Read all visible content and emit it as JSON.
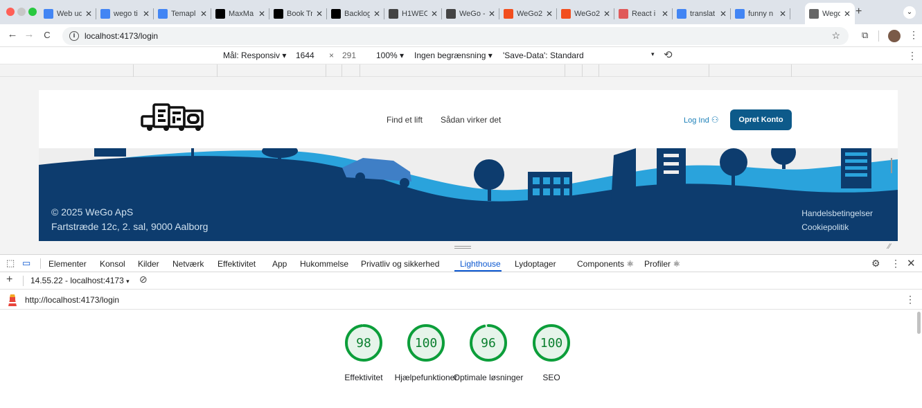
{
  "browser": {
    "tabs": [
      {
        "label": "Web ud",
        "icon": "docs-icon",
        "color": "#4285f4"
      },
      {
        "label": "wego ti",
        "icon": "docs-icon",
        "color": "#4285f4"
      },
      {
        "label": "Temapl",
        "icon": "docs-icon",
        "color": "#4285f4"
      },
      {
        "label": "MaxMa",
        "icon": "github-icon",
        "color": "#000000"
      },
      {
        "label": "Book Tr",
        "icon": "github-icon",
        "color": "#000000"
      },
      {
        "label": "Backlog",
        "icon": "github-icon",
        "color": "#000000"
      },
      {
        "label": "H1WEO",
        "icon": "check-circle-icon",
        "color": "#444444"
      },
      {
        "label": "WeGo -",
        "icon": "globe-icon",
        "color": "#444444"
      },
      {
        "label": "WeGo2",
        "icon": "figma-icon",
        "color": "#f24e1e"
      },
      {
        "label": "WeGo2",
        "icon": "figma-icon",
        "color": "#f24e1e"
      },
      {
        "label": "React i",
        "icon": "react-icon",
        "color": "#e05a5a"
      },
      {
        "label": "translat",
        "icon": "google-icon",
        "color": "#4285f4"
      },
      {
        "label": "funny n",
        "icon": "google-icon",
        "color": "#4285f4"
      },
      {
        "label": "Wego",
        "icon": "wego-icon",
        "color": "#666666",
        "active": true
      }
    ],
    "new_tab": "+",
    "url": "localhost:4173/login"
  },
  "device_toolbar": {
    "dimensions_label": "Mål: Responsiv",
    "width": "1644",
    "x": "×",
    "height": "291",
    "zoom": "100%",
    "throttle": "Ingen begrænsning",
    "save_data": "'Save-Data': Standard"
  },
  "site": {
    "logo": "WEGO",
    "nav": [
      "Find et lift",
      "Sådan virker det"
    ],
    "login": "Log Ind",
    "signup": "Opret Konto",
    "copyright": "© 2025 WeGo ApS",
    "address": "Fartstræde 12c, 2. sal, 9000 Aalborg",
    "links": [
      "Handelsbetingelser",
      "Cookiepolitik"
    ],
    "colors": {
      "dark_blue": "#0d3c6e",
      "light_blue": "#2aa3dc",
      "button": "#0d5a8a"
    }
  },
  "devtools": {
    "tabs": [
      "Elementer",
      "Konsol",
      "Kilder",
      "Netværk",
      "Effektivitet",
      "App",
      "Hukommelse",
      "Privatliv og sikkerhed",
      "Lighthouse",
      "Lydoptager",
      "Components ⚛",
      "Profiler ⚛"
    ],
    "selected_tab": "Lighthouse",
    "report_select": "14.55.22 - localhost:4173",
    "report_url": "http://localhost:4173/login",
    "scores": [
      {
        "value": 98,
        "label": "Effektivitet"
      },
      {
        "value": 100,
        "label": "Hjælpefunktioner"
      },
      {
        "value": 96,
        "label": "Optimale løsninger"
      },
      {
        "value": 100,
        "label": "SEO"
      }
    ],
    "score_color": "#0c9e3a"
  }
}
